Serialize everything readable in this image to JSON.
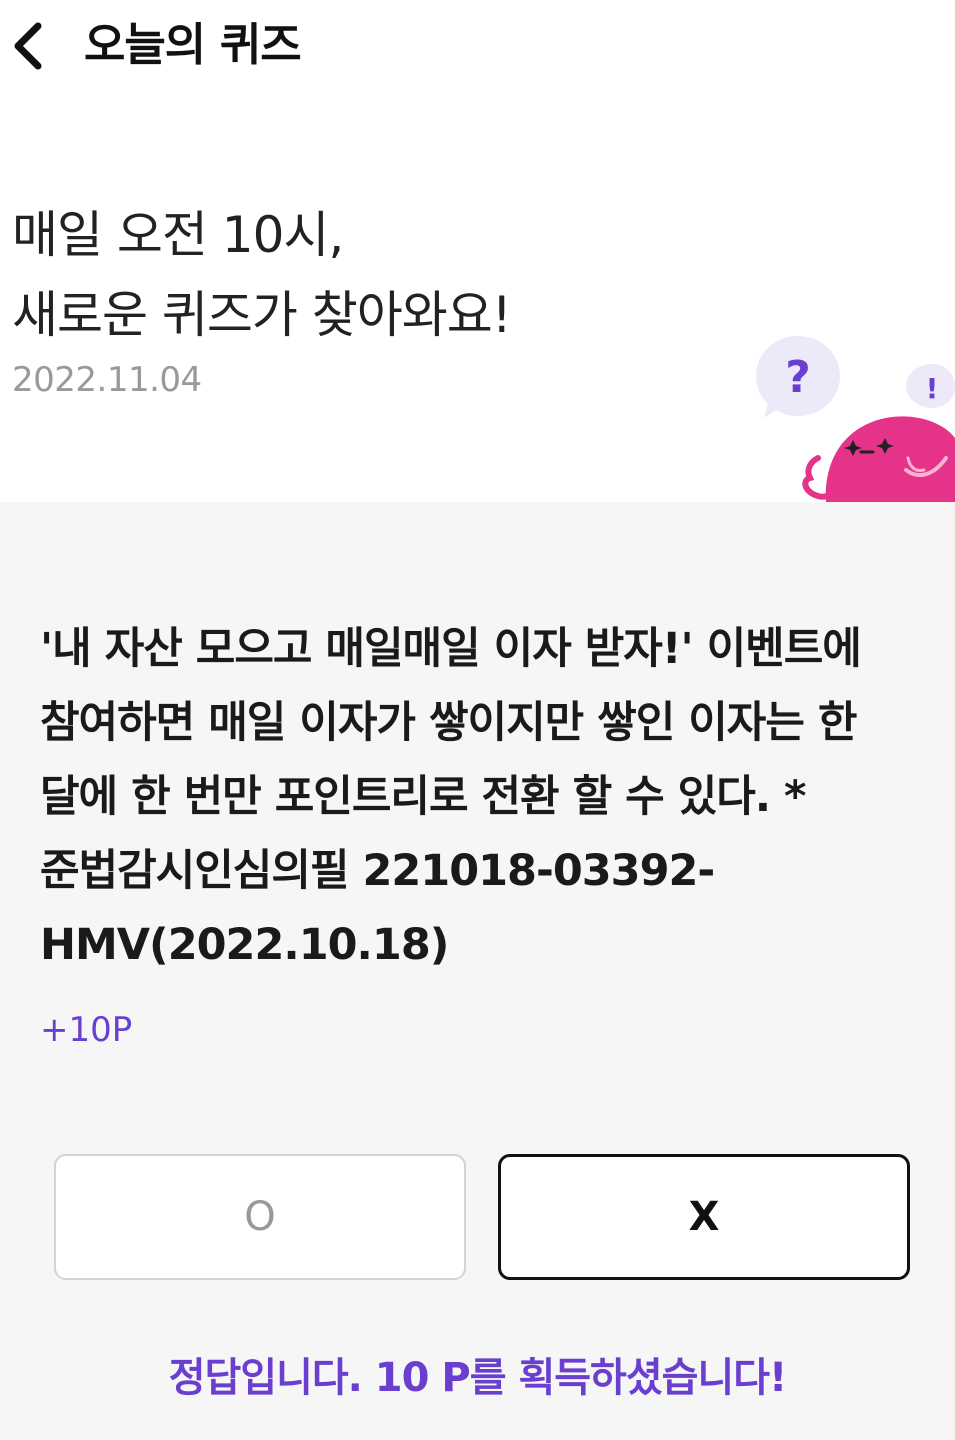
{
  "header": {
    "title": "오늘의 퀴즈"
  },
  "hero": {
    "title_line1": "매일 오전 10시,",
    "title_line2": "새로운 퀴즈가 찾아와요!",
    "date": "2022.11.04"
  },
  "mascot": {
    "question_mark": "?",
    "exclamation_mark": "!"
  },
  "quiz": {
    "question": "'내 자산 모으고 매일매일 이자 받자!' 이벤트에 참여하면 매일 이자가 쌓이지만 쌓인 이자는 한 달에 한 번만 포인트리로 전환 할 수 있다. *준법감시인심의필 221018-03392-HMV(2022.10.18)",
    "points": "+10P",
    "option_o": "O",
    "option_x": "X",
    "result": "정답입니다. 10 P를 획득하셨습니다!"
  },
  "colors": {
    "accent": "#6a3fcf",
    "mascot_pink": "#e6338a",
    "bubble": "#ece9f8"
  }
}
